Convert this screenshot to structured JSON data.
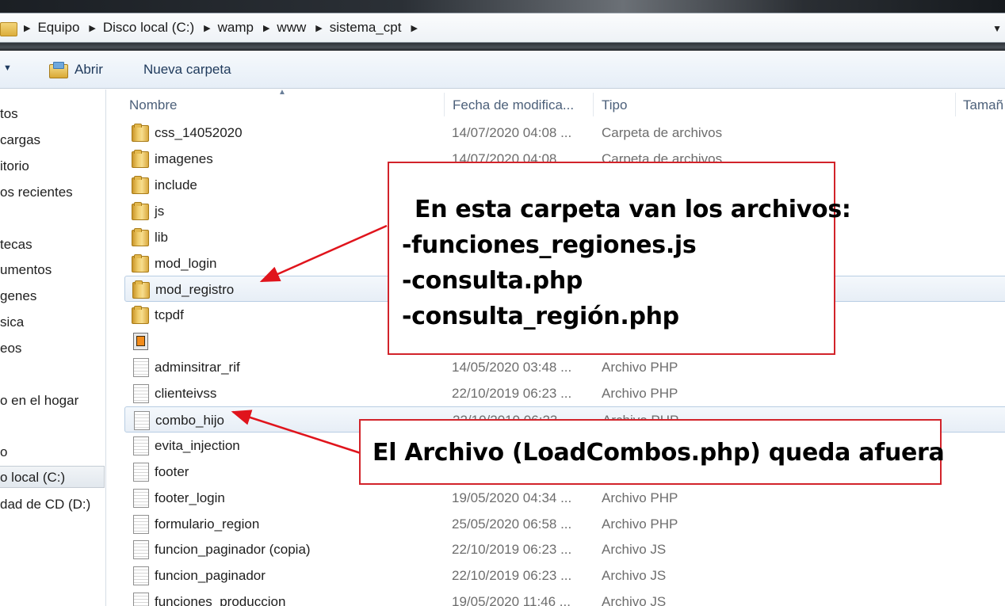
{
  "address_bar": {
    "crumbs": [
      "Equipo",
      "Disco local (C:)",
      "wamp",
      "www",
      "sistema_cpt"
    ]
  },
  "toolbar": {
    "open_label": "Abrir",
    "new_folder_label": "Nueva carpeta"
  },
  "nav_pane": {
    "items": [
      {
        "label": "tos"
      },
      {
        "label": "cargas"
      },
      {
        "label": "itorio"
      },
      {
        "label": "os recientes"
      },
      {
        "label": "tecas"
      },
      {
        "label": "umentos"
      },
      {
        "label": "genes"
      },
      {
        "label": "sica"
      },
      {
        "label": "eos"
      },
      {
        "label": "o en el hogar"
      },
      {
        "label": "o"
      },
      {
        "label": "o local (C:)",
        "selected": true
      },
      {
        "label": "dad de CD (D:)"
      }
    ]
  },
  "columns": {
    "name": "Nombre",
    "date": "Fecha de modifica...",
    "type": "Tipo",
    "size": "Tamañ"
  },
  "files": [
    {
      "name": "css_14052020",
      "date": "14/07/2020 04:08 ...",
      "type": "Carpeta de archivos",
      "icon": "folder-icon"
    },
    {
      "name": "imagenes",
      "date": "14/07/2020 04:08 ...",
      "type": "Carpeta de archivos",
      "icon": "folder-icon"
    },
    {
      "name": "include",
      "date": "",
      "type": "",
      "icon": "folder-icon"
    },
    {
      "name": "js",
      "date": "",
      "type": "",
      "icon": "folder-icon"
    },
    {
      "name": "lib",
      "date": "",
      "type": "",
      "icon": "folder-icon"
    },
    {
      "name": "mod_login",
      "date": "",
      "type": "",
      "icon": "folder-icon"
    },
    {
      "name": "mod_registro",
      "date": "",
      "type": "",
      "icon": "folder-icon",
      "selected": true
    },
    {
      "name": "tcpdf",
      "date": "",
      "type": "",
      "icon": "folder-icon"
    },
    {
      "name": "",
      "date": "",
      "type": "",
      "icon": "sublime-file-icon"
    },
    {
      "name": "adminsitrar_rif",
      "date": "14/05/2020 03:48 ...",
      "type": "Archivo PHP",
      "icon": "document-icon"
    },
    {
      "name": "clienteivss",
      "date": "22/10/2019 06:23 ...",
      "type": "Archivo PHP",
      "icon": "document-icon"
    },
    {
      "name": "combo_hijo",
      "date": "22/10/2019 06:23 ...",
      "type": "Archivo PHP",
      "icon": "document-icon",
      "selected": true
    },
    {
      "name": "evita_injection",
      "date": "",
      "type": "",
      "icon": "document-icon"
    },
    {
      "name": "footer",
      "date": "",
      "type": "",
      "icon": "document-icon"
    },
    {
      "name": "footer_login",
      "date": "19/05/2020 04:34 ...",
      "type": "Archivo PHP",
      "icon": "document-icon"
    },
    {
      "name": "formulario_region",
      "date": "25/05/2020 06:58 ...",
      "type": "Archivo PHP",
      "icon": "document-icon"
    },
    {
      "name": "funcion_paginador (copia)",
      "date": "22/10/2019 06:23 ...",
      "type": "Archivo JS",
      "icon": "document-icon"
    },
    {
      "name": "funcion_paginador",
      "date": "22/10/2019 06:23 ...",
      "type": "Archivo JS",
      "icon": "document-icon"
    },
    {
      "name": "funciones_produccion",
      "date": "19/05/2020 11:46 ...",
      "type": "Archivo JS",
      "icon": "document-icon"
    }
  ],
  "annotations": {
    "callout_folder": {
      "title": "En esta carpeta van los archivos:",
      "lines": [
        "-funciones_regiones.js",
        "-consulta.php",
        "-consulta_región.php"
      ]
    },
    "callout_file": {
      "text": "El Archivo (LoadCombos.php) queda afuera"
    },
    "accent_color": "#d2232a"
  }
}
